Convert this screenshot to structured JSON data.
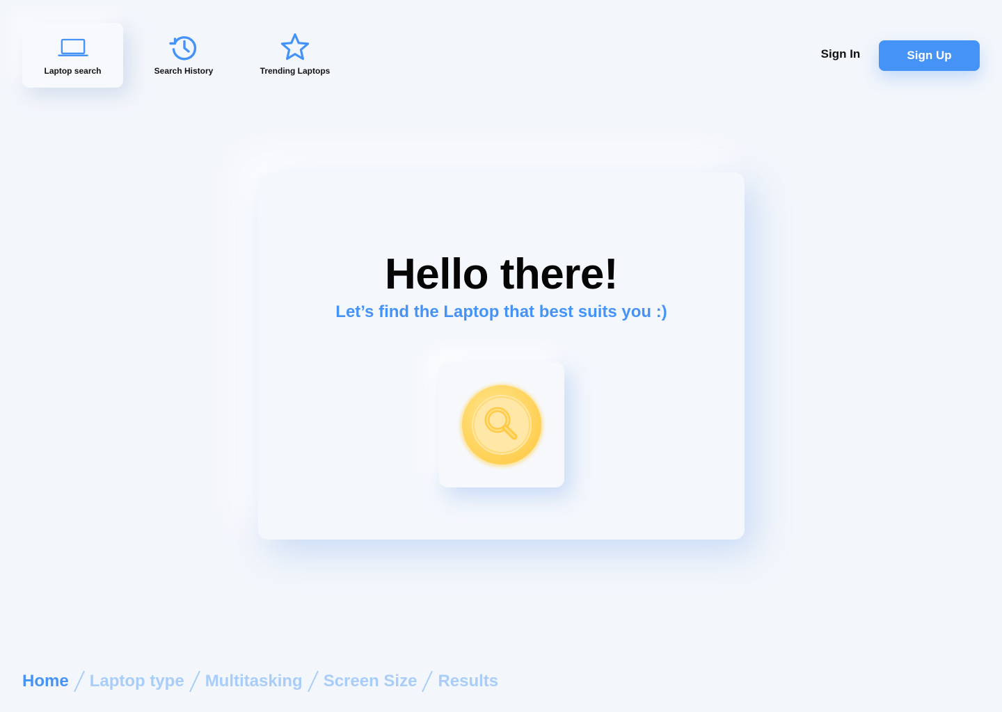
{
  "nav": {
    "items": [
      {
        "label": "Laptop search",
        "icon": "laptop-icon",
        "active": true
      },
      {
        "label": "Search History",
        "icon": "history-icon",
        "active": false
      },
      {
        "label": "Trending Laptops",
        "icon": "star-icon",
        "active": false
      }
    ],
    "sign_in_label": "Sign In",
    "sign_up_label": "Sign Up"
  },
  "hero": {
    "title": "Hello there!",
    "subtitle": "Let’s find the Laptop that best suits you :)",
    "action_icon": "magnifier-icon"
  },
  "breadcrumb": {
    "items": [
      "Home",
      "Laptop type",
      "Multitasking",
      "Screen Size",
      "Results"
    ],
    "current_index": 0
  },
  "colors": {
    "accent": "#4593f7",
    "accent_light": "#a9cdf9",
    "background": "#f3f6fb",
    "search_badge": "#ffd35c",
    "text": "#050505"
  }
}
